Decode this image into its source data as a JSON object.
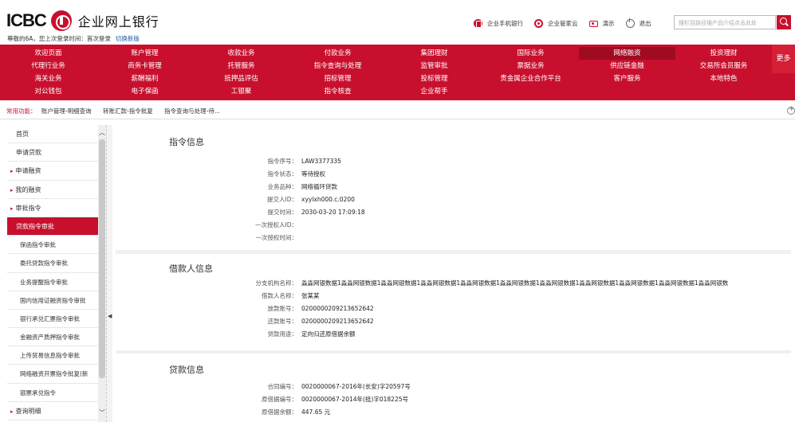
{
  "header": {
    "logo_text": "ICBC",
    "bank_name": "企业网上银行",
    "welcome": "尊敬的6A，您上次登录时间：首次登录",
    "switch_link": "切换新版",
    "links": [
      {
        "label": "企业手机银行",
        "icon": "phone-icon"
      },
      {
        "label": "企业管家云",
        "icon": "cloud-icon"
      },
      {
        "label": "演示",
        "icon": "demo-icon"
      },
      {
        "label": "退出",
        "icon": "exit-icon"
      }
    ],
    "search_placeholder": "搜栏目路径搜产品介绍点击此处"
  },
  "menu": {
    "rows": [
      [
        "欢迎页面",
        "账户管理",
        "收款业务",
        "付款业务",
        "集团理财",
        "国际业务",
        "网络融资",
        "投资理财"
      ],
      [
        "代理行业务",
        "商务卡管理",
        "托管服务",
        "指令查询与处理",
        "监管审批",
        "票据业务",
        "供应链金融",
        "交易所会员服务"
      ],
      [
        "海关业务",
        "薪酬福利",
        "抵押品评估",
        "招标管理",
        "投标管理",
        "贵金属企业合作平台",
        "客户服务",
        "本地特色"
      ],
      [
        "对公钱包",
        "电子保函",
        "工银聚",
        "指令核查",
        "企业帮手",
        "",
        "",
        ""
      ]
    ],
    "active": "网络融资",
    "more_label": "更多"
  },
  "quick": {
    "label": "常用功能：",
    "items": [
      "账户管理-明细查询",
      "转账汇款-指令批复",
      "指令查询与处理-待..."
    ]
  },
  "sidebar": {
    "items": [
      {
        "label": "首页",
        "kind": "plain"
      },
      {
        "label": "申请贷款",
        "kind": "plain"
      },
      {
        "label": "申请融资",
        "kind": "grp"
      },
      {
        "label": "我的融资",
        "kind": "grp"
      },
      {
        "label": "审批指令",
        "kind": "grp"
      },
      {
        "label": "贷款指令审批",
        "kind": "sel"
      },
      {
        "label": "保函指令审批",
        "kind": "sub"
      },
      {
        "label": "委托贷款指令审批",
        "kind": "sub"
      },
      {
        "label": "业务提醒指令审批",
        "kind": "sub"
      },
      {
        "label": "国内信用证融资指令审批",
        "kind": "sub"
      },
      {
        "label": "银行承兑汇票指令审批",
        "kind": "sub"
      },
      {
        "label": "金融资产质押指令审批",
        "kind": "sub"
      },
      {
        "label": "上传贸易信息指令审批",
        "kind": "sub"
      },
      {
        "label": "网络融资开票指令批复(新",
        "kind": "sub"
      },
      {
        "label": "银票承兑指令",
        "kind": "sub"
      },
      {
        "label": "查询明细",
        "kind": "grp"
      }
    ]
  },
  "sections": [
    {
      "title": "指令信息",
      "rows": [
        {
          "label": "指令序号：",
          "value": "LAW3377335"
        },
        {
          "label": "指令状态：",
          "value": "等待授权"
        },
        {
          "label": "业务品种：",
          "value": "网络循环贷款"
        },
        {
          "label": "提交人ID：",
          "value": "xyylxh000.c.0200"
        },
        {
          "label": "提交时间：",
          "value": "2030-03-20 17:09:18"
        },
        {
          "label": "一次授权人ID：",
          "value": ""
        },
        {
          "label": "一次授权时间：",
          "value": ""
        }
      ]
    },
    {
      "title": "借款人信息",
      "rows": [
        {
          "label": "分支机构名称：",
          "value": "淼淼网银数据1淼淼网银数据1淼淼网银数据1淼淼网银数据1淼淼网银数据1淼淼网银数据1淼淼网银数据1淼淼网银数据1淼淼网银数据1淼淼网银数据1淼淼网银数"
        },
        {
          "label": "借款人名称：",
          "value": "张某某"
        },
        {
          "label": "放款账号：",
          "value": "0200000209213652642"
        },
        {
          "label": "还款账号：",
          "value": "0200000209213652642"
        },
        {
          "label": "贷款用途：",
          "value": "定向归还原借据余额"
        }
      ]
    },
    {
      "title": "贷款信息",
      "rows": [
        {
          "label": "合同编号：",
          "value": "0020000067-2016年(长安)字20597号"
        },
        {
          "label": "原借据编号：",
          "value": "0020000067-2014年(抵)字018225号"
        },
        {
          "label": "原借据余额：",
          "value": "447.65 元"
        }
      ]
    }
  ]
}
